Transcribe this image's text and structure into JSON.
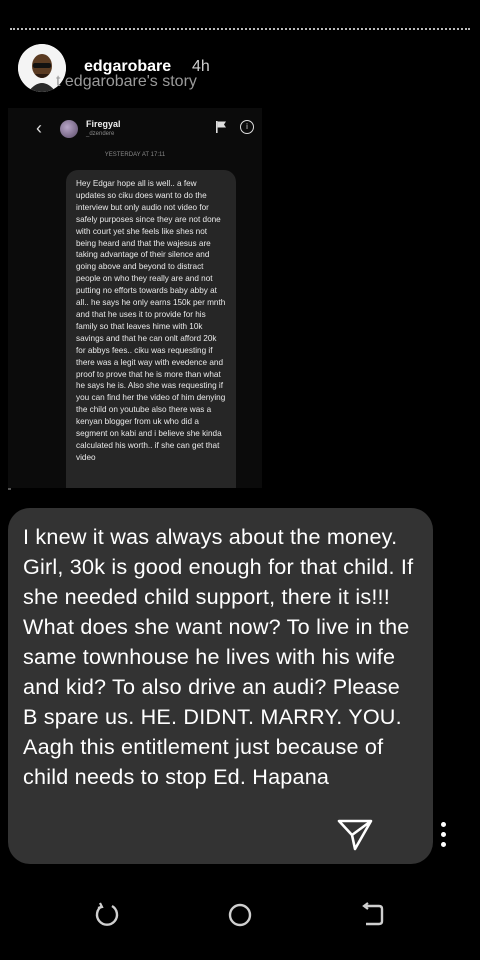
{
  "story": {
    "username": "edgarobare",
    "time": "4h",
    "subline": "t edgarobare's story"
  },
  "dm": {
    "contact_name": "Firegyal",
    "contact_handle": "_dzendere",
    "date_label": "YESTERDAY AT 17:11",
    "message": "Hey Edgar hope all is well.. a few updates so ciku does want to do the interview but only audio not video for safely purposes since they are not done with court yet she feels like shes not being heard and that the wajesus are taking advantage of their silence and going above and beyond to distract people on who they really are and not putting no efforts towards baby abby at all.. he says he only earns 150k per mnth and that he uses it to provide for his family so that leaves hime with 10k savings and that he can onlt afford 20k for abbys fees.. ciku was requesting if there was a legit way with evedence and proof to prove that he is more than what he says he is. Also she was requesting if you can find her the video of him denying the child on youtube also there was a kenyan blogger from uk who did a segment on kabi and i believe she kinda calculated his worth.. if she can get that video"
  },
  "comment": {
    "text": "I knew it was always about the money. Girl, 30k is good enough for that child. If she needed child support, there it is!!! What does she want now? To live in the same townhouse he lives with his wife and kid? To also drive an audi? Please B spare us. HE. DIDNT. MARRY. YOU. Aagh this entitlement just because of child needs to stop Ed. Hapana"
  },
  "icons": {
    "send": "send-icon",
    "more": "more-vertical-icon",
    "recent": "recent-apps-icon",
    "home": "home-icon",
    "back": "back-icon"
  }
}
